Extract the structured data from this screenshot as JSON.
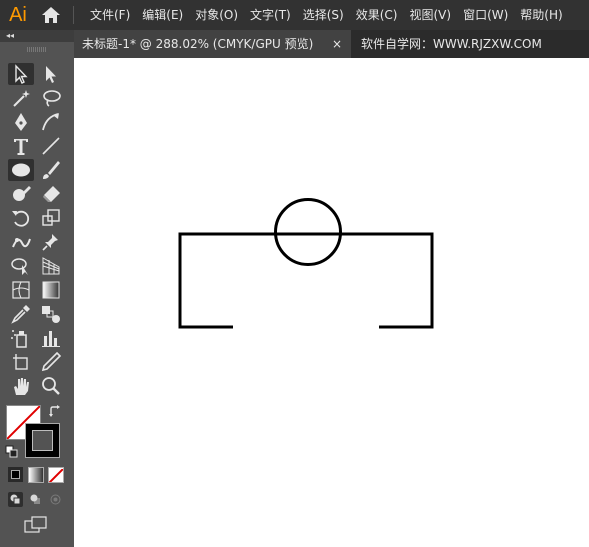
{
  "app": {
    "logo": "Ai"
  },
  "menu": [
    "文件(F)",
    "编辑(E)",
    "对象(O)",
    "文字(T)",
    "选择(S)",
    "效果(C)",
    "视图(V)",
    "窗口(W)",
    "帮助(H)"
  ],
  "tabs": {
    "document_title": "未标题-1* @ 288.02% (CMYK/GPU 预览)",
    "close_glyph": "×",
    "website": "软件自学网：WWW.RJZXW.COM"
  },
  "tools_panel": {
    "collapse_glyph": "◂◂",
    "active_tool": "ellipse-tool",
    "fill_color": "#ffffff",
    "stroke_color": "#000000"
  },
  "colors": {
    "accent": "#ff9a00",
    "menubar_bg": "#323232",
    "panel_bg": "#535353"
  }
}
